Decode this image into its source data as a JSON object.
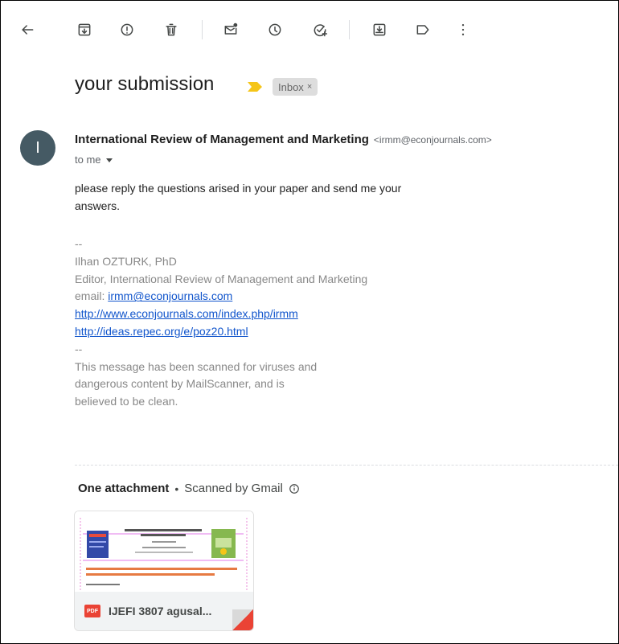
{
  "colors": {
    "avatar_bg": "#455a64",
    "link": "#1155cc",
    "importance_marker": "#f5c518",
    "pdf_badge": "#ea4335"
  },
  "toolbar": {
    "icons": [
      "back-arrow-icon",
      "archive-icon",
      "report-spam-icon",
      "delete-icon",
      "mark-unread-icon",
      "snooze-icon",
      "add-task-icon",
      "move-to-icon",
      "label-icon",
      "more-options-icon"
    ]
  },
  "email": {
    "subject": "your submission",
    "labels": [
      {
        "name": "Inbox",
        "remove_glyph": "×"
      }
    ],
    "avatar_letter": "I",
    "sender_name": "International Review of Management and Marketing",
    "sender_email": "<irmm@econjournals.com>",
    "to_text": "to me",
    "body_lines": [
      "please reply the questions arised in your paper and send me your",
      "answers."
    ],
    "signature": {
      "separator_top": "--",
      "name": "Ilhan OZTURK, PhD",
      "title": "Editor, International Review of Management and Marketing",
      "email_prefix": "email: ",
      "email_link": "irmm@econjournals.com",
      "link_1": "http://www.econjournals.com/index.php/irmm",
      "link_2": "http://ideas.repec.org/e/poz20.html",
      "separator_bottom": "--",
      "scanner_lines": [
        "This message has been scanned for viruses and",
        "dangerous content by MailScanner, and is",
        "believed to be clean."
      ]
    }
  },
  "attachments": {
    "title": "One attachment",
    "separator": "•",
    "scan_status": "Scanned by Gmail",
    "file": {
      "badge": "PDF",
      "name": "IJEFI 3807 agusal..."
    }
  }
}
